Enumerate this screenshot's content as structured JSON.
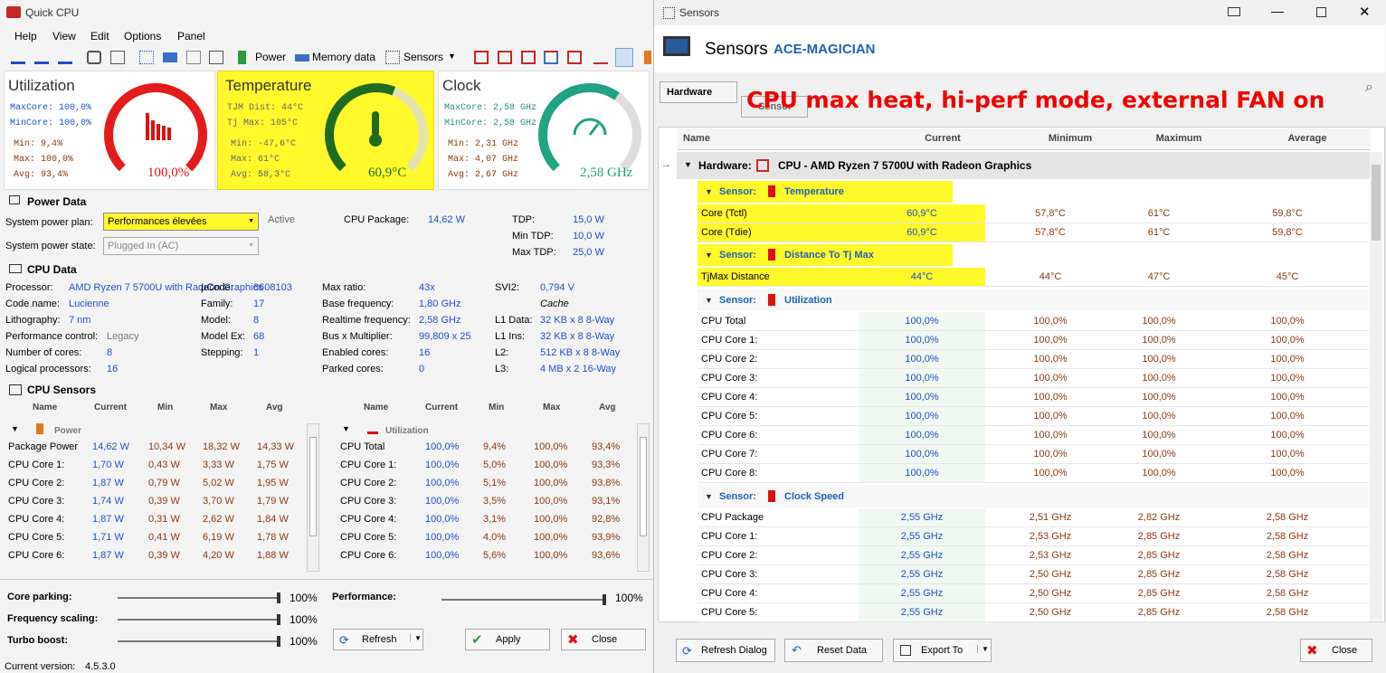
{
  "left": {
    "title": "Quick CPU",
    "menu": [
      "Help",
      "View",
      "Edit",
      "Options",
      "Panel"
    ],
    "toolbar": {
      "power": "Power",
      "memory": "Memory data",
      "sensors": "Sensors"
    },
    "util": {
      "title": "Utilization",
      "maxcore": "MaxCore: 100,0%",
      "mincore": "MinCore: 100,0%",
      "min": "Min:   9,4%",
      "max": "Max:   100,0%",
      "avg": "Avg:   93,4%",
      "value": "100,0%",
      "level": 1.0
    },
    "temp": {
      "title": "Temperature",
      "tjm": "TJM Dist:  44°C",
      "tjmax": "Tj Max:    105°C",
      "min": "Min:   -47,6°C",
      "max": "Max:   61°C",
      "avg": "Avg:   58,3°C",
      "value": "60,9°C",
      "level": 0.58
    },
    "clock": {
      "title": "Clock",
      "maxcore": "MaxCore: 2,58 GHz",
      "mincore": "MinCore: 2,58 GHz",
      "min": "Min:   2,31 GHz",
      "max": "Max:   4,07 GHz",
      "avg": "Avg:   2,67 GHz",
      "value": "2,58 GHz",
      "level": 0.63
    },
    "power": {
      "title": "Power Data",
      "plan_label": "System power plan:",
      "plan_value": "Performances élevées",
      "active": "Active",
      "state_label": "System power state:",
      "state_value": "Plugged In (AC)",
      "pkg_label": "CPU Package:",
      "pkg_value": "14,62 W",
      "tdp_label": "TDP:",
      "tdp_value": "15,0 W",
      "mintdp_label": "Min TDP:",
      "mintdp_value": "10,0 W",
      "maxtdp_label": "Max TDP:",
      "maxtdp_value": "25,0 W"
    },
    "cpu": {
      "title": "CPU Data",
      "items": [
        [
          "Processor:",
          "AMD Ryzen 7 5700U with Radeon Graphics"
        ],
        [
          "Code name:",
          "Lucienne"
        ],
        [
          "Lithography:",
          "7 nm"
        ],
        [
          "Performance control:",
          "Legacy"
        ],
        [
          "Number of cores:",
          "8"
        ],
        [
          "Logical processors:",
          "16"
        ]
      ],
      "items2": [
        [
          "µCode:",
          "8608103"
        ],
        [
          "Family:",
          "17"
        ],
        [
          "Model:",
          "8"
        ],
        [
          "Model Ex:",
          "68"
        ],
        [
          "Stepping:",
          "1"
        ]
      ],
      "items3": [
        [
          "Max ratio:",
          "43x"
        ],
        [
          "Base frequency:",
          "1,80 GHz"
        ],
        [
          "Realtime frequency:",
          "2,58 GHz"
        ],
        [
          "Bus x Multiplier:",
          "99,809 x 25"
        ],
        [
          "Enabled cores:",
          "16"
        ],
        [
          "Parked cores:",
          "0"
        ]
      ],
      "items4": [
        [
          "SVI2:",
          "0,794 V"
        ],
        [
          "",
          "Cache"
        ],
        [
          "L1 Data:",
          "32 KB x 8  8-Way"
        ],
        [
          "L1 Ins:",
          "32 KB x 8  8-Way"
        ],
        [
          "L2:",
          "512 KB x 8  8-Way"
        ],
        [
          "L3:",
          "4 MB x 2  16-Way"
        ]
      ]
    },
    "sensors": {
      "title": "CPU Sensors",
      "cols": [
        "Name",
        "Current",
        "Min",
        "Max",
        "Avg"
      ],
      "power_group": "Power",
      "power_rows": [
        [
          "Package Power",
          "14,62 W",
          "10,34 W",
          "18,32 W",
          "14,33 W"
        ],
        [
          "CPU Core 1:",
          "1,70 W",
          "0,43 W",
          "3,33 W",
          "1,75 W"
        ],
        [
          "CPU Core 2:",
          "1,87 W",
          "0,79 W",
          "5,02 W",
          "1,95 W"
        ],
        [
          "CPU Core 3:",
          "1,74 W",
          "0,39 W",
          "3,70 W",
          "1,79 W"
        ],
        [
          "CPU Core 4:",
          "1,87 W",
          "0,31 W",
          "2,62 W",
          "1,84 W"
        ],
        [
          "CPU Core 5:",
          "1,71 W",
          "0,41 W",
          "6,19 W",
          "1,78 W"
        ],
        [
          "CPU Core 6:",
          "1,87 W",
          "0,39 W",
          "4,20 W",
          "1,88 W"
        ]
      ],
      "util_group": "Utilization",
      "util_rows": [
        [
          "CPU Total",
          "100,0%",
          "9,4%",
          "100,0%",
          "93,4%"
        ],
        [
          "CPU Core 1:",
          "100,0%",
          "5,0%",
          "100,0%",
          "93,3%"
        ],
        [
          "CPU Core 2:",
          "100,0%",
          "5,1%",
          "100,0%",
          "93,8%"
        ],
        [
          "CPU Core 3:",
          "100,0%",
          "3,5%",
          "100,0%",
          "93,1%"
        ],
        [
          "CPU Core 4:",
          "100,0%",
          "3,1%",
          "100,0%",
          "92,8%"
        ],
        [
          "CPU Core 5:",
          "100,0%",
          "4,0%",
          "100,0%",
          "93,9%"
        ],
        [
          "CPU Core 6:",
          "100,0%",
          "5,6%",
          "100,0%",
          "93,6%"
        ]
      ]
    },
    "controls": {
      "parking": "Core parking:",
      "parking_v": "100%",
      "freq": "Frequency scaling:",
      "freq_v": "100%",
      "turbo": "Turbo boost:",
      "turbo_v": "100%",
      "perf": "Performance:",
      "perf_v": "100%",
      "refresh": "Refresh",
      "apply": "Apply",
      "close": "Close"
    },
    "status": {
      "label": "Current version:",
      "value": "4.5.3.0"
    }
  },
  "right": {
    "title": "Sensors",
    "heading": "Sensors",
    "machine": "ACE-MAGICIAN",
    "hardware_btn": "Hardware",
    "sensor_btn": "Sensor",
    "annotation": "CPU max heat, hi-perf mode, external FAN on",
    "cols": [
      "Name",
      "Current",
      "Minimum",
      "Maximum",
      "Average"
    ],
    "hw_label": "Hardware:",
    "hw_name": "CPU - AMD Ryzen 7 5700U with Radeon Graphics",
    "sensor_word": "Sensor:",
    "g_temp": "Temperature",
    "g_dist": "Distance To Tj Max",
    "g_util": "Utilization",
    "g_clock": "Clock Speed",
    "temp_rows": [
      [
        "Core (Tctl)",
        "60,9°C",
        "57,8°C",
        "61°C",
        "59,8°C"
      ],
      [
        "Core (Tdie)",
        "60,9°C",
        "57,8°C",
        "61°C",
        "59,8°C"
      ]
    ],
    "dist_rows": [
      [
        "TjMax Distance",
        "44°C",
        "44°C",
        "47°C",
        "45°C"
      ]
    ],
    "util_rows": [
      [
        "CPU Total",
        "100,0%",
        "100,0%",
        "100,0%",
        "100,0%"
      ],
      [
        "CPU Core 1:",
        "100,0%",
        "100,0%",
        "100,0%",
        "100,0%"
      ],
      [
        "CPU Core 2:",
        "100,0%",
        "100,0%",
        "100,0%",
        "100,0%"
      ],
      [
        "CPU Core 3:",
        "100,0%",
        "100,0%",
        "100,0%",
        "100,0%"
      ],
      [
        "CPU Core 4:",
        "100,0%",
        "100,0%",
        "100,0%",
        "100,0%"
      ],
      [
        "CPU Core 5:",
        "100,0%",
        "100,0%",
        "100,0%",
        "100,0%"
      ],
      [
        "CPU Core 6:",
        "100,0%",
        "100,0%",
        "100,0%",
        "100,0%"
      ],
      [
        "CPU Core 7:",
        "100,0%",
        "100,0%",
        "100,0%",
        "100,0%"
      ],
      [
        "CPU Core 8:",
        "100,0%",
        "100,0%",
        "100,0%",
        "100,0%"
      ]
    ],
    "clock_rows": [
      [
        "CPU Package",
        "2,55 GHz",
        "2,51 GHz",
        "2,82 GHz",
        "2,58 GHz"
      ],
      [
        "CPU Core 1:",
        "2,55 GHz",
        "2,53 GHz",
        "2,85 GHz",
        "2,58 GHz"
      ],
      [
        "CPU Core 2:",
        "2,55 GHz",
        "2,53 GHz",
        "2,85 GHz",
        "2,58 GHz"
      ],
      [
        "CPU Core 3:",
        "2,55 GHz",
        "2,50 GHz",
        "2,85 GHz",
        "2,58 GHz"
      ],
      [
        "CPU Core 4:",
        "2,55 GHz",
        "2,50 GHz",
        "2,85 GHz",
        "2,58 GHz"
      ],
      [
        "CPU Core 5:",
        "2,55 GHz",
        "2,50 GHz",
        "2,85 GHz",
        "2,58 GHz"
      ]
    ],
    "buttons": {
      "refresh": "Refresh Dialog",
      "reset": "Reset Data",
      "export": "Export To",
      "close": "Close"
    }
  }
}
